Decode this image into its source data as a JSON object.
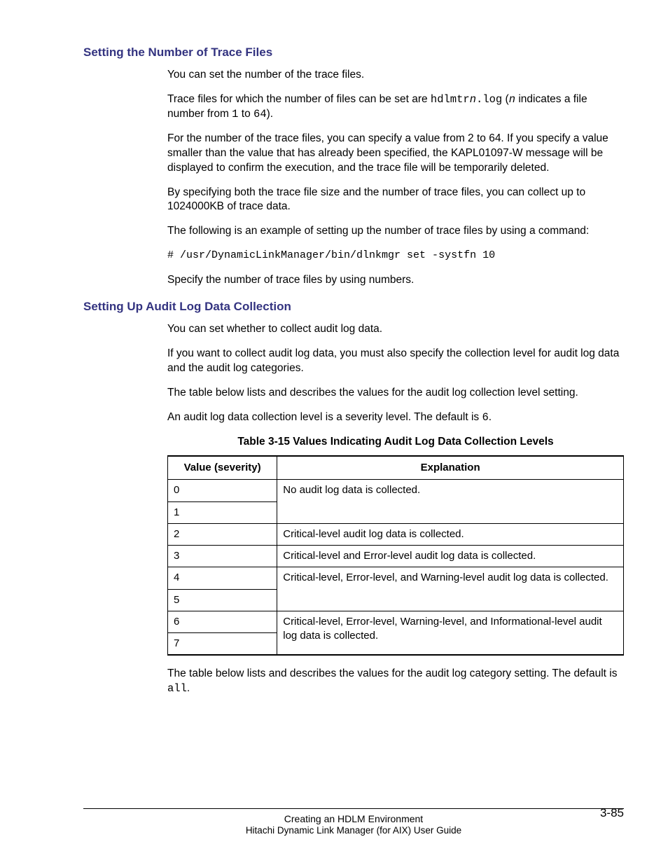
{
  "section1": {
    "heading": "Setting the Number of Trace Files",
    "p1": "You can set the number of the trace files.",
    "p2a": "Trace files for which the number of files can be set are ",
    "p2_code1": "hdlmtr",
    "p2_codeitalic": "n",
    "p2_code2": ".log",
    "p2b": " (",
    "p2_codeitalic2": "n",
    "p2c": " indicates a file number from ",
    "p2_code3": "1",
    "p2d": " to ",
    "p2_code4": "64",
    "p2e": ").",
    "p3": "For the number of the trace files, you can specify a value from 2 to 64. If you specify a value smaller than the value that has already been specified, the KAPL01097-W message will be displayed to confirm the execution, and the trace file will be temporarily deleted.",
    "p4": "By specifying both the trace file size and the number of trace files, you can collect up to 1024000KB of trace data.",
    "p5": "The following is an example of setting up the number of trace files by using a command:",
    "cmd": "# /usr/DynamicLinkManager/bin/dlnkmgr set -systfn 10",
    "p6": "Specify the number of trace files by using numbers."
  },
  "section2": {
    "heading": "Setting Up Audit Log Data Collection",
    "p1": "You can set whether to collect audit log data.",
    "p2": "If you want to collect audit log data, you must also specify the collection level for audit log data and the audit log categories.",
    "p3": "The table below lists and describes the values for the audit log collection level setting.",
    "p4a": "An audit log data collection level is a severity level. The default is ",
    "p4_code": "6",
    "p4b": ".",
    "table_caption": "Table 3-15 Values Indicating Audit Log Data Collection Levels",
    "th1": "Value (severity)",
    "th2": "Explanation",
    "r0v": "0",
    "r0e": "No audit log data is collected.",
    "r1v": "1",
    "r2v": "2",
    "r2e": "Critical-level audit log data is collected.",
    "r3v": "3",
    "r3e": "Critical-level and Error-level audit log data is collected.",
    "r4v": "4",
    "r4e": "Critical-level, Error-level, and Warning-level audit log data is collected.",
    "r5v": "5",
    "r6v": "6",
    "r6e": "Critical-level, Error-level, Warning-level, and Informational-level audit log data is collected.",
    "r7v": "7",
    "p5a": "The table below lists and describes the values for the audit log category setting. The default is ",
    "p5_code": "all",
    "p5b": "."
  },
  "footer": {
    "line1": "Creating an HDLM Environment",
    "line2": "Hitachi Dynamic Link Manager (for AIX) User Guide",
    "page": "3-85"
  }
}
